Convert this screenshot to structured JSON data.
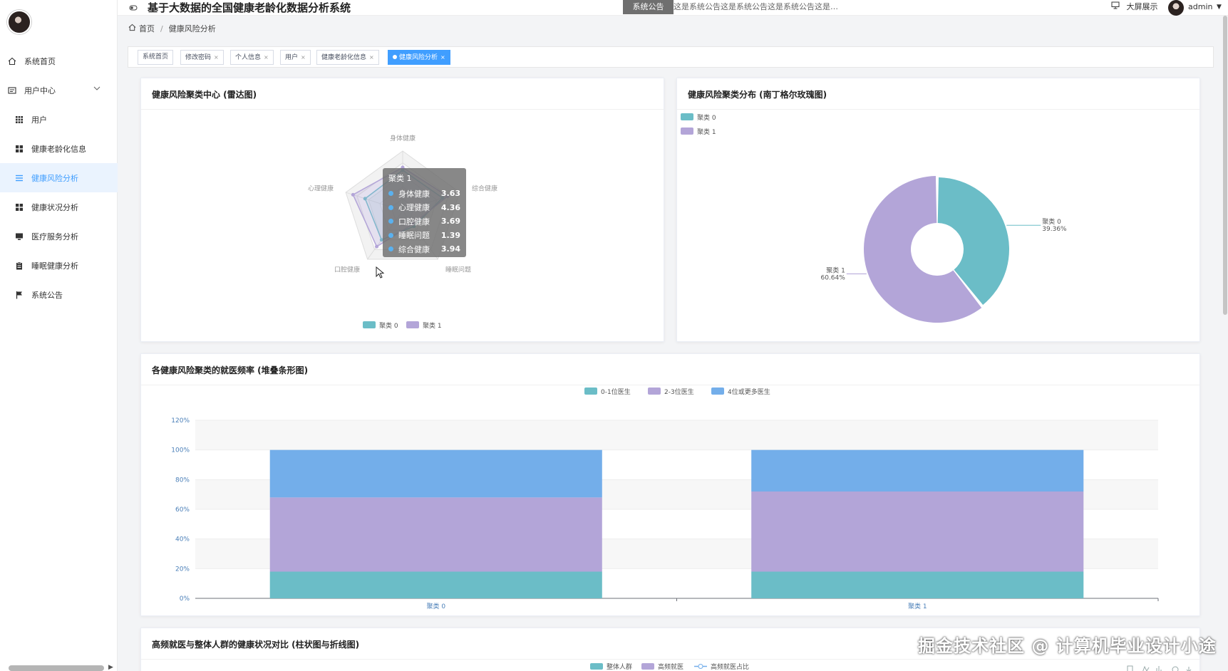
{
  "header": {
    "title": "基于大数据的全国健康老龄化数据分析系统",
    "notice_label": "系统公告",
    "notice_text": "这是系统公告这是系统公告这是系统公告这是…",
    "bigscreen_label": "大屏展示",
    "username": "admin"
  },
  "sidebar": {
    "items": [
      {
        "label": "系统首页",
        "icon": "home-icon"
      },
      {
        "label": "用户中心",
        "icon": "id-card-icon"
      },
      {
        "label": "用户",
        "icon": "grid-icon"
      },
      {
        "label": "健康老龄化信息",
        "icon": "apps-icon"
      },
      {
        "label": "健康风险分析",
        "icon": "list-icon"
      },
      {
        "label": "健康状况分析",
        "icon": "apps-icon"
      },
      {
        "label": "医疗服务分析",
        "icon": "monitor-icon"
      },
      {
        "label": "睡眠健康分析",
        "icon": "clipboard-icon"
      },
      {
        "label": "系统公告",
        "icon": "flag-icon"
      }
    ]
  },
  "breadcrumb": {
    "home": "首页",
    "current": "健康风险分析"
  },
  "tabs": [
    {
      "label": "系统首页"
    },
    {
      "label": "修改密码"
    },
    {
      "label": "个人信息"
    },
    {
      "label": "用户"
    },
    {
      "label": "健康老龄化信息"
    },
    {
      "label": "健康风险分析"
    }
  ],
  "colors": {
    "cluster0": "#6bbdc7",
    "cluster1": "#b3a5d8",
    "visits4": "#73aeea",
    "accent": "#409eff"
  },
  "cards": {
    "radar_title": "健康风险聚类中心 (雷达图)",
    "rose_title": "健康风险聚类分布 (南丁格尔玫瑰图)",
    "bar_title": "各健康风险聚类的就医频率 (堆叠条形图)",
    "compare_title": "高频就医与整体人群的健康状况对比 (柱状图与折线图)"
  },
  "tooltip": {
    "title": "聚类 1",
    "rows": [
      {
        "label": "身体健康",
        "value": "3.63"
      },
      {
        "label": "心理健康",
        "value": "4.36"
      },
      {
        "label": "口腔健康",
        "value": "3.69"
      },
      {
        "label": "睡眠问题",
        "value": "1.39"
      },
      {
        "label": "综合健康",
        "value": "3.94"
      }
    ]
  },
  "compare_legend": [
    "整体人群",
    "高频就医",
    "高频就医占比"
  ],
  "watermark": "掘金技术社区 @ 计算机毕业设计小途",
  "chart_data": [
    {
      "type": "radar",
      "title": "健康风险聚类中心 (雷达图)",
      "indicators": [
        "身体健康",
        "综合健康",
        "睡眠问题",
        "口腔健康",
        "心理健康"
      ],
      "series": [
        {
          "name": "聚类 0",
          "values": [
            3.4,
            3.5,
            1.6,
            3.0,
            3.3
          ]
        },
        {
          "name": "聚类 1",
          "values": [
            3.63,
            3.94,
            1.39,
            3.69,
            4.36
          ]
        }
      ],
      "max": 5,
      "legend": "bottom-center"
    },
    {
      "type": "pie",
      "title": "健康风险聚类分布 (南丁格尔玫瑰图)",
      "slices": [
        {
          "name": "聚类 0",
          "percent": "39.36%",
          "value": 39.36
        },
        {
          "name": "聚类 1",
          "percent": "60.64%",
          "value": 60.64
        }
      ],
      "legend": "top-left"
    },
    {
      "type": "bar",
      "title": "各健康风险聚类的就医频率 (堆叠条形图)",
      "categories": [
        "聚类 0",
        "聚类 1"
      ],
      "series": [
        {
          "name": "0-1位医生",
          "values": [
            18,
            18
          ]
        },
        {
          "name": "2-3位医生",
          "values": [
            50,
            54
          ]
        },
        {
          "name": "4位或更多医生",
          "values": [
            32,
            28
          ]
        }
      ],
      "yticks": [
        "0%",
        "20%",
        "40%",
        "60%",
        "80%",
        "100%",
        "120%"
      ],
      "ylim": [
        0,
        120
      ],
      "legend": "top-center"
    }
  ]
}
